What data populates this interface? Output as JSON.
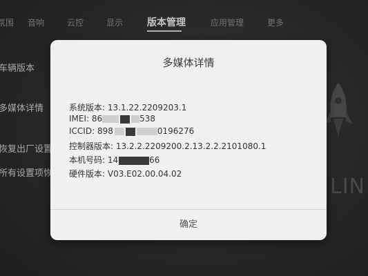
{
  "topnav": {
    "tabs": [
      {
        "label": "氛围"
      },
      {
        "label": "音响"
      },
      {
        "label": "云控"
      },
      {
        "label": "显示"
      },
      {
        "label": "版本管理"
      },
      {
        "label": "应用管理"
      },
      {
        "label": "更多"
      }
    ],
    "active_tab": "版本管理"
  },
  "sidebar": {
    "items": [
      {
        "label": "车辆版本"
      },
      {
        "label": "多媒体详情"
      },
      {
        "label": "恢复出厂设置"
      },
      {
        "label": "所有设置项恢"
      }
    ]
  },
  "background": {
    "brand_fragment": "LIN"
  },
  "dialog": {
    "title": "多媒体详情",
    "rows": [
      {
        "label": "系统版本: ",
        "value": "13.1.22.2209203.1"
      },
      {
        "label": "IMEI: ",
        "value_start": "86",
        "value_end": "538"
      },
      {
        "label": "ICCID: ",
        "value_start": "898",
        "value_end": "0196276"
      },
      {
        "label": "控制器版本: ",
        "value": "13.2.2.2209200.2.13.2.2.2101080.1"
      },
      {
        "label": "本机号码: ",
        "value_start": "14",
        "value_end": "66"
      },
      {
        "label": "硬件版本: ",
        "value": "V03.E02.00.04.02"
      }
    ],
    "confirm_label": "确定"
  }
}
